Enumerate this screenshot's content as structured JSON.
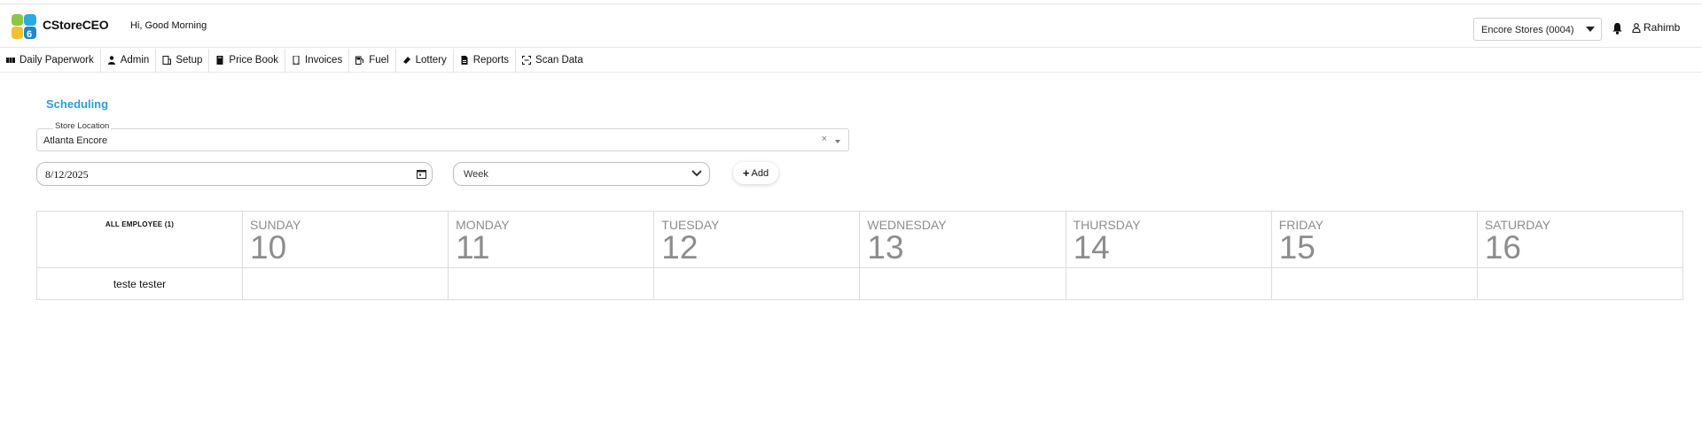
{
  "app": {
    "brand": "CStoreCEO",
    "greeting": "Hi, Good Morning",
    "store_selector": "Encore Stores (0004)",
    "user": "Rahimb"
  },
  "nav": [
    {
      "label": "Daily Paperwork",
      "icon": "grid-icon"
    },
    {
      "label": "Admin",
      "icon": "person-icon"
    },
    {
      "label": "Setup",
      "icon": "building-icon"
    },
    {
      "label": "Price Book",
      "icon": "book-icon"
    },
    {
      "label": "Invoices",
      "icon": "receipt-icon"
    },
    {
      "label": "Fuel",
      "icon": "fuel-pump-icon"
    },
    {
      "label": "Lottery",
      "icon": "ticket-icon"
    },
    {
      "label": "Reports",
      "icon": "report-icon"
    },
    {
      "label": "Scan Data",
      "icon": "scan-icon"
    }
  ],
  "page": {
    "title": "Scheduling",
    "store_location": {
      "legend": "Store Location",
      "value": "Atlanta Encore",
      "clear": "×"
    },
    "date_value": "8/12/2025",
    "view_select": "Week",
    "add_label": "Add"
  },
  "schedule": {
    "employee_header": "ALL EMPLOYEE (1)",
    "days": [
      {
        "name": "SUNDAY",
        "num": "10"
      },
      {
        "name": "MONDAY",
        "num": "11"
      },
      {
        "name": "TUESDAY",
        "num": "12"
      },
      {
        "name": "WEDNESDAY",
        "num": "13"
      },
      {
        "name": "THURSDAY",
        "num": "14"
      },
      {
        "name": "FRIDAY",
        "num": "15"
      },
      {
        "name": "SATURDAY",
        "num": "16"
      }
    ],
    "employees": [
      {
        "name": "teste tester"
      }
    ]
  },
  "colors": {
    "accent": "#2a9fd6",
    "day_text": "#8d8d8d",
    "logo_green": "#8cc63f",
    "logo_blue": "#29abe2"
  }
}
